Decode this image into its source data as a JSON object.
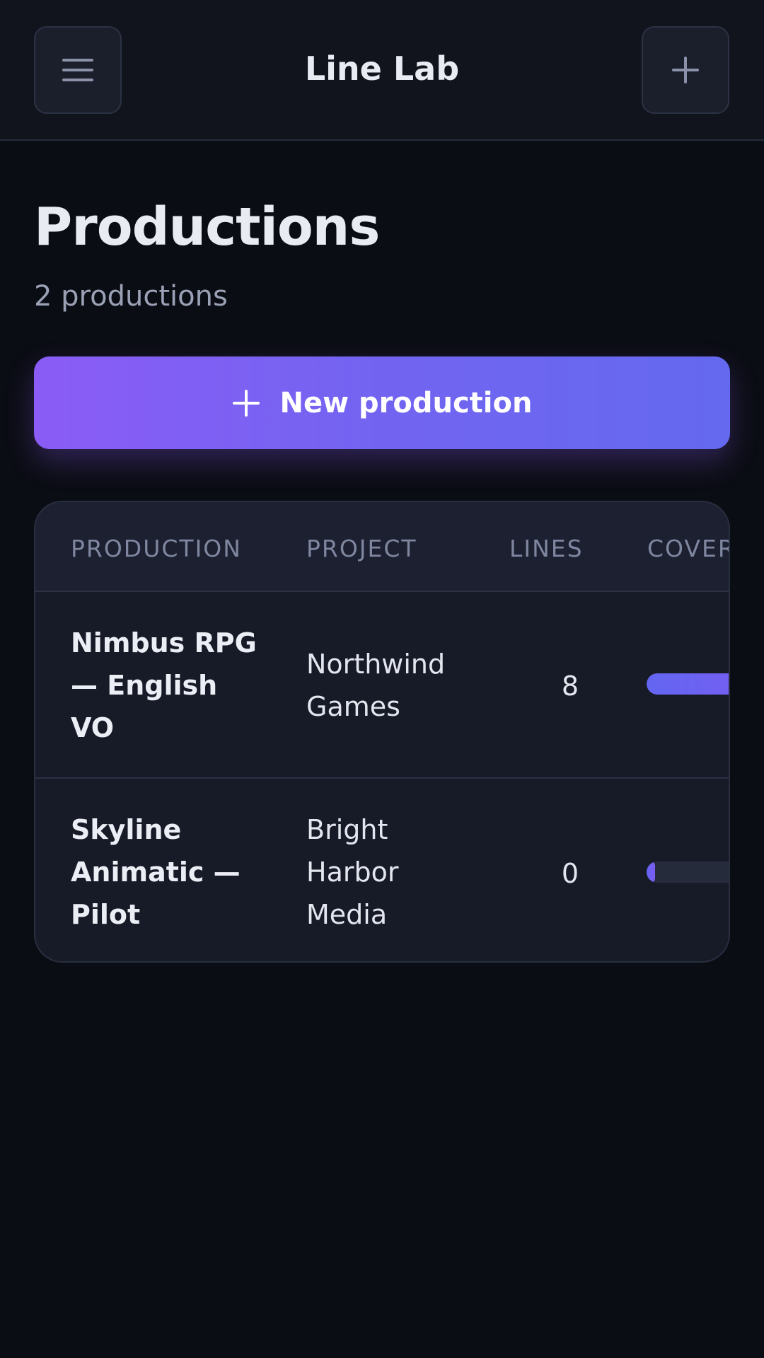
{
  "header": {
    "title": "Line Lab",
    "menu_icon": "menu-icon",
    "add_icon": "plus-icon"
  },
  "page": {
    "title": "Productions",
    "subtitle": "2 productions"
  },
  "new_button": {
    "label": "New production",
    "icon": "plus-icon"
  },
  "table": {
    "columns": [
      "PRODUCTION",
      "PROJECT",
      "LINES",
      "COVER"
    ],
    "rows": [
      {
        "production": [
          "Nimbus RPG",
          "— English",
          "VO"
        ],
        "project": [
          "Northwind",
          "Games"
        ],
        "lines": "8",
        "coverage": 1.0
      },
      {
        "production": [
          "Skyline",
          "Animatic —",
          "Pilot"
        ],
        "project": [
          "Bright",
          "Harbor",
          "Media"
        ],
        "lines": "0",
        "coverage": 0.0
      }
    ]
  },
  "colors": {
    "background": "#0b0d14",
    "accent_start": "#8b5cf6",
    "accent_end": "#6366f1"
  }
}
